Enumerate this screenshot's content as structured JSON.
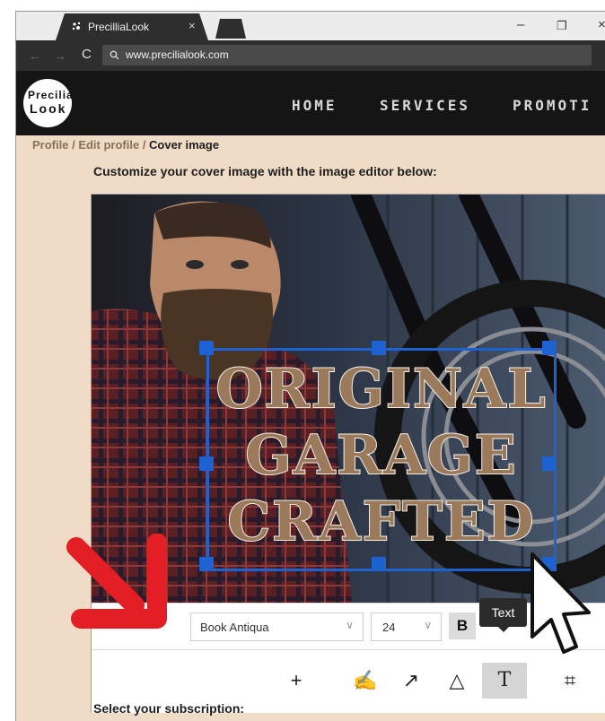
{
  "browser": {
    "tab_title": "PrecilliaLook",
    "tab_close": "×",
    "url": "www.precilialook.com",
    "window_buttons": {
      "minimize": "–",
      "restore": "❐",
      "close": "×"
    },
    "nav": {
      "back": "←",
      "forward": "→",
      "reload": "C",
      "search": "🔍"
    }
  },
  "site": {
    "logo_line1": "Precilia",
    "logo_line2": "Look",
    "nav_items": [
      "HOME",
      "SERVICES",
      "PROMOTI"
    ]
  },
  "breadcrumb": {
    "items": [
      "Profile",
      "Edit profile"
    ],
    "separator": " / ",
    "current": "Cover image"
  },
  "instruction": "Customize your cover image with the image editor below:",
  "editor": {
    "overlay_text": [
      "ORIGINAL",
      "GARAGE",
      "CRAFTED"
    ],
    "font_family": "Book Antiqua",
    "font_size": "24",
    "bold_label": "B",
    "tooltip": "Text",
    "dropdown_chevron": "∨",
    "tools": [
      {
        "name": "add",
        "glyph": "+"
      },
      {
        "name": "draw",
        "glyph": "✍"
      },
      {
        "name": "arrow",
        "glyph": "↗"
      },
      {
        "name": "shape",
        "glyph": "△"
      },
      {
        "name": "text",
        "glyph": "T"
      },
      {
        "name": "crop",
        "glyph": "⌗"
      }
    ],
    "colors": {
      "handle": "#1d62d0",
      "text_fill": "#9b7a5b"
    }
  },
  "subscription_label": "Select your subscription:",
  "annotation": {
    "arrow_color": "#e31e24"
  }
}
